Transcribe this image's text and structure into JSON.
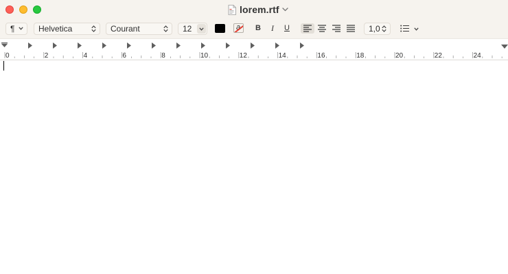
{
  "window": {
    "title": "lorem.rtf"
  },
  "toolbar": {
    "paragraph_style": "¶",
    "font_family": "Helvetica",
    "font_typeface": "Courant",
    "font_size": "12",
    "text_color": "#000000",
    "bold_label": "B",
    "italic_label": "I",
    "underline_label": "U",
    "alignment_selected": "left",
    "line_spacing": "1,0"
  },
  "ruler": {
    "labels": [
      "0",
      "2",
      "4",
      "6",
      "8",
      "10",
      "12",
      "14",
      "16",
      "18",
      "20",
      "22",
      "24"
    ]
  },
  "document": {
    "text": ""
  },
  "colors": {
    "chrome": "#f6f3ee",
    "close": "#fe5f57",
    "minimize": "#febc2e",
    "zoom": "#28c840"
  }
}
